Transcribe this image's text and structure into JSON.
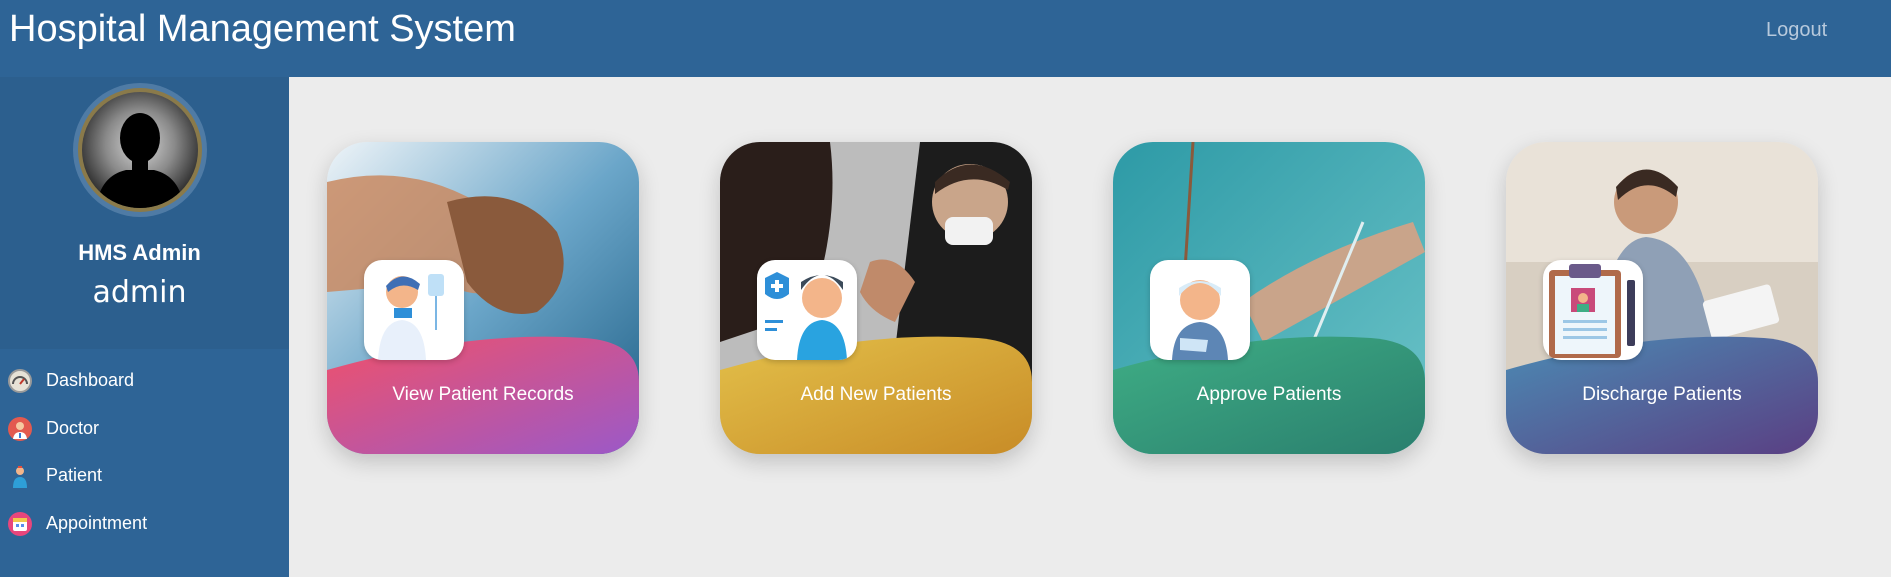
{
  "header": {
    "title": "Hospital Management System",
    "logout_label": "Logout"
  },
  "sidebar": {
    "profile": {
      "name": "HMS Admin",
      "role": "admin"
    },
    "items": [
      {
        "label": "Dashboard",
        "icon": "dashboard-gauge-icon"
      },
      {
        "label": "Doctor",
        "icon": "doctor-icon"
      },
      {
        "label": "Patient",
        "icon": "patient-icon"
      },
      {
        "label": "Appointment",
        "icon": "calendar-icon"
      }
    ]
  },
  "cards": [
    {
      "label": "View Patient Records",
      "icon": "patient-records-icon",
      "gradient": [
        "#f0516a",
        "#9b59c8"
      ]
    },
    {
      "label": "Add New Patients",
      "icon": "add-patient-icon",
      "gradient": [
        "#e3c04a",
        "#c88c27"
      ]
    },
    {
      "label": "Approve Patients",
      "icon": "approve-patient-icon",
      "gradient": [
        "#3fae85",
        "#2a7f6e"
      ]
    },
    {
      "label": "Discharge Patients",
      "icon": "discharge-clipboard-icon",
      "gradient": [
        "#4b8bb4",
        "#5a3f83"
      ]
    }
  ],
  "colors": {
    "header_bg": "#2e6496",
    "sidebar_bg": "#2e6496",
    "page_bg": "#ececec"
  }
}
